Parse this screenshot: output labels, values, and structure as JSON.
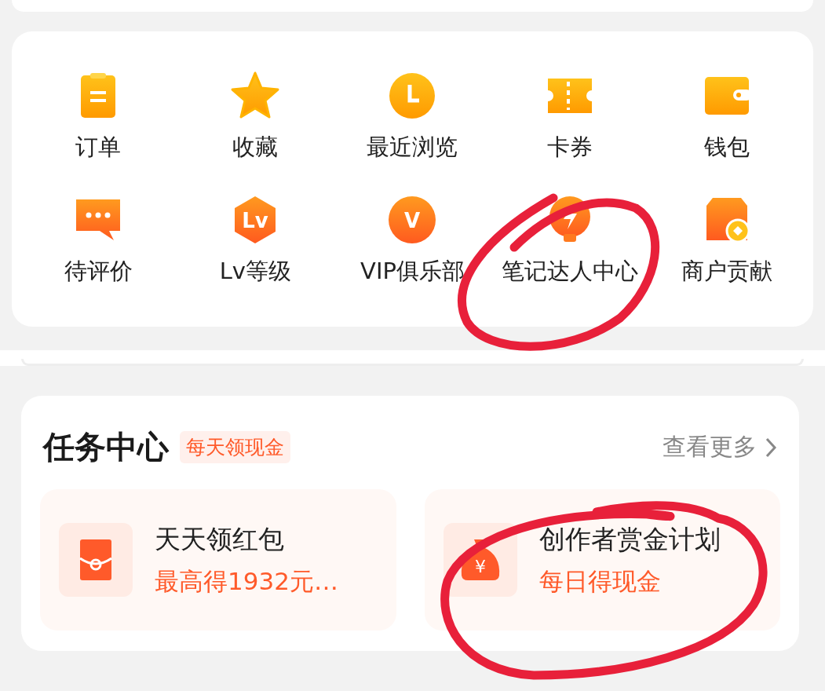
{
  "shortcuts": [
    {
      "kind": "order",
      "label": "订单"
    },
    {
      "kind": "star",
      "label": "收藏"
    },
    {
      "kind": "clock",
      "label": "最近浏览"
    },
    {
      "kind": "ticket",
      "label": "卡券"
    },
    {
      "kind": "wallet",
      "label": "钱包"
    },
    {
      "kind": "comment",
      "label": "待评价"
    },
    {
      "kind": "level",
      "label": "Lv等级",
      "icon_text": "Lv"
    },
    {
      "kind": "vip",
      "label": "VIP俱乐部",
      "icon_text": "V"
    },
    {
      "kind": "bolt",
      "label": "笔记达人中心"
    },
    {
      "kind": "shop",
      "label": "商户贡献"
    }
  ],
  "task_center": {
    "title": "任务中心",
    "tag": "每天领现金",
    "more": "查看更多",
    "tasks": [
      {
        "kind": "red-packet",
        "title": "天天领红包",
        "subtitle": "最高得1932元…"
      },
      {
        "kind": "money-bag",
        "title": "创作者赏金计划",
        "subtitle": "每日得现金",
        "icon_text": "¥"
      }
    ]
  }
}
